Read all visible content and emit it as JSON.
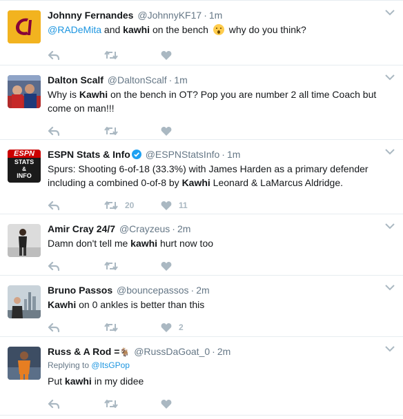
{
  "tweets": [
    {
      "name": "Johnny Fernandes",
      "handle": "@JohnnyKF17",
      "time": "1m",
      "text_parts": {
        "mention": "@RADeMita",
        "t1": " and ",
        "kw": "kawhi",
        "t2": " on the bench ",
        "t3": " why do you think?"
      },
      "retweets": "",
      "likes": ""
    },
    {
      "name": "Dalton Scalf",
      "handle": "@DaltonScalf",
      "time": "1m",
      "text_parts": {
        "t1": "Why is ",
        "kw": "Kawhi",
        "t2": " on the bench in OT? Pop you are number 2 all time Coach but come on man!!!"
      },
      "retweets": "",
      "likes": ""
    },
    {
      "name": "ESPN Stats & Info",
      "handle": "@ESPNStatsInfo",
      "time": "1m",
      "avatar_lines": [
        "ESPN",
        "STATS",
        "&",
        "INFO"
      ],
      "text_parts": {
        "t1": "Spurs: Shooting 6-of-18 (33.3%) with James Harden as a primary defender including a combined 0-of-8 by ",
        "kw": "Kawhi",
        "t2": " Leonard & LaMarcus Aldridge."
      },
      "retweets": "20",
      "likes": "11"
    },
    {
      "name": "Amir Cray 24/7",
      "handle": "@Crayzeus",
      "time": "2m",
      "text_parts": {
        "t1": "Damn don't tell me ",
        "kw": "kawhi",
        "t2": " hurt now too"
      },
      "retweets": "",
      "likes": ""
    },
    {
      "name": "Bruno Passos",
      "handle": "@bouncepassos",
      "time": "2m",
      "text_parts": {
        "kw": "Kawhi",
        "t2": " on 0 ankles is better than this"
      },
      "retweets": "",
      "likes": "2"
    },
    {
      "name": "Russ & A Rod =",
      "handle": "@RussDaGoat_0",
      "time": "2m",
      "replying_label": "Replying to",
      "replying_to": "@ItsGPop",
      "text_parts": {
        "t1": "Put ",
        "kw": "kawhi",
        "t2": " in my didee"
      },
      "retweets": "",
      "likes": ""
    }
  ],
  "separator": "·",
  "colors": {
    "accent": "#1b95e0",
    "muted": "#657786",
    "icon": "#aab8c2",
    "border": "#e6ecf0"
  },
  "icons": [
    "reply-icon",
    "retweet-icon",
    "like-icon",
    "caret-down-icon",
    "verified-icon",
    "face-emoji-icon",
    "goat-emoji-icon"
  ]
}
